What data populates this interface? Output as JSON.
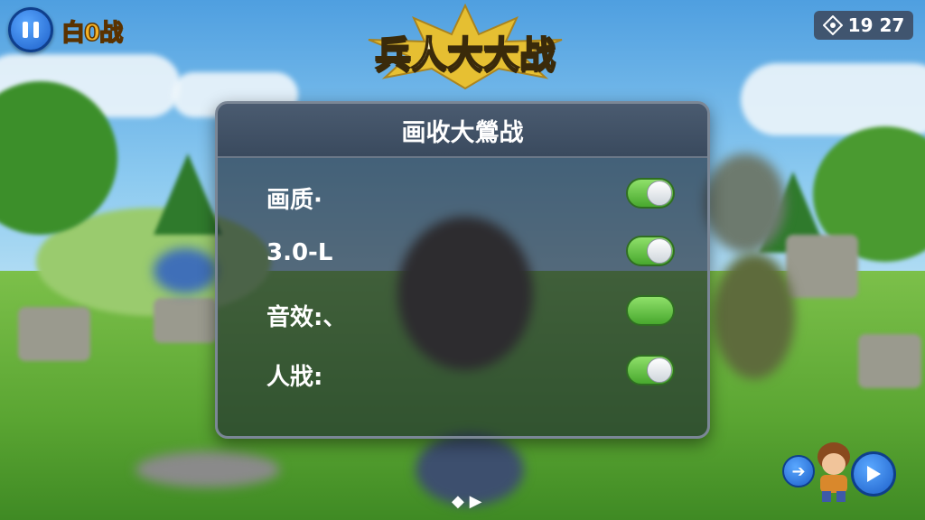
{
  "hud": {
    "battle_count": "白0战",
    "game_title": "兵人大大战",
    "timer": "19 27"
  },
  "settings_panel": {
    "title": "画收大鶯战",
    "rows": [
      {
        "label": "画质·",
        "toggle": "on"
      },
      {
        "label": "3.0-L",
        "toggle": "on"
      },
      {
        "label": "音效:、",
        "toggle": "on"
      },
      {
        "label": "人戕:",
        "toggle": "on"
      }
    ]
  },
  "footer": {
    "page_indicator": "◆ ▶"
  },
  "colors": {
    "toggle_on": "#5cc23a",
    "panel_bg": "#1c2430",
    "accent_blue": "#1d5fc9",
    "title_gold": "#f2b126"
  },
  "icons": [
    "pause-icon",
    "timer-icon",
    "arrow-right-icon",
    "play-icon"
  ]
}
